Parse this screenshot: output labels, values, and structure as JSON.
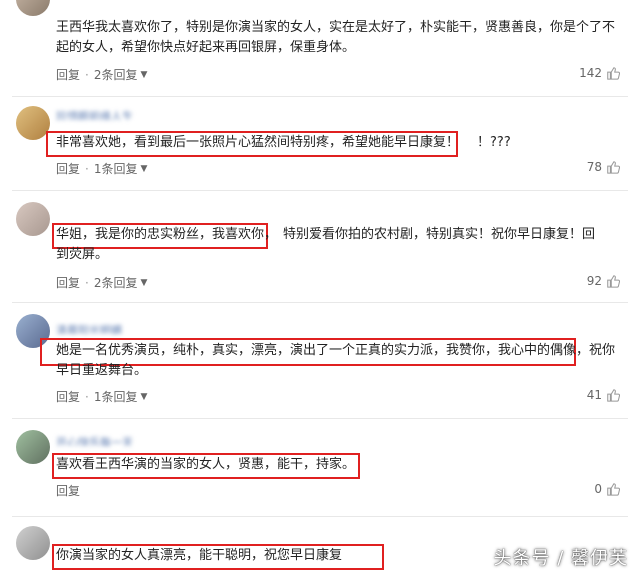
{
  "comments": [
    {
      "username": "",
      "text_plain": "王西华我太喜欢你了，特别是你演当家的女人，实在是太好了，朴实能干，贤惠善良，你是个了不起的女人，希望你快点好起来再回银屏，保重身体。",
      "reply_label": "回复",
      "replies_label": "2条回复",
      "likes": "142"
    },
    {
      "username": "珍惜眼前缘人生",
      "text_highlight": "非常喜欢她，看到最后一张照片心猛然间特别疼，希望她能早日康复！",
      "text_rest": "！???",
      "reply_label": "回复",
      "replies_label": "1条回复",
      "likes": "78"
    },
    {
      "username": "",
      "text_highlight": "华姐，我是你的忠实粉丝，我喜欢你，",
      "text_rest": "特别爱看你拍的农村剧，特别真实！祝你早日康复！回到荧屏。",
      "reply_label": "回复",
      "replies_label": "2条回复",
      "likes": "92"
    },
    {
      "username": "清晨阳光明媚",
      "text_highlight": "她是一名优秀演员，纯朴，真实，漂亮，演出了一个正真的实力派，我赞你，我心中的偶像，",
      "text_rest": "祝你早日重返舞台。",
      "reply_label": "回复",
      "replies_label": "1条回复",
      "likes": "41"
    },
    {
      "username": "开心快乐每一天",
      "text_highlight": "喜欢看王西华演的当家的女人，贤惠，能干，持家。",
      "reply_label": "回复",
      "likes": "0"
    },
    {
      "username": "",
      "text_highlight": "你演当家的女人真漂亮，能干聪明，祝您早日康复"
    }
  ],
  "watermark": "头条号 / 馨伊芙",
  "colors": {
    "highlight_border": "#e02020",
    "text": "#222222",
    "meta": "#666666"
  }
}
